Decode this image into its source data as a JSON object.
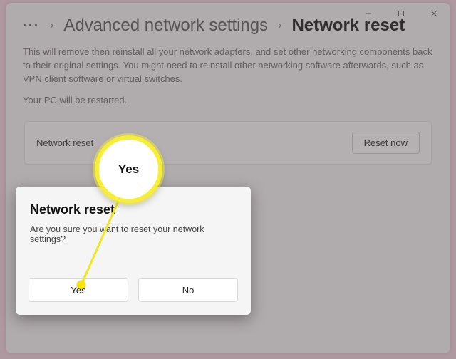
{
  "breadcrumb": {
    "parent": "Advanced network settings",
    "current": "Network reset"
  },
  "description": "This will remove then reinstall all your network adapters, and set other networking components back to their original settings. You might need to reinstall other networking software afterwards, such as VPN client software or virtual switches.",
  "restart_note": "Your PC will be restarted.",
  "card": {
    "label": "Network reset",
    "button": "Reset now"
  },
  "dialog": {
    "title": "Network reset",
    "message": "Are you sure you want to reset your network settings?",
    "yes": "Yes",
    "no": "No"
  },
  "callout": {
    "label": "Yes"
  }
}
